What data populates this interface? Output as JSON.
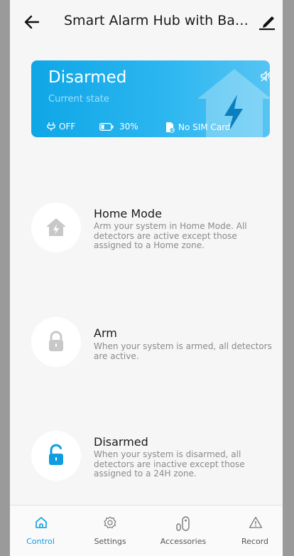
{
  "header": {
    "title": "Smart Alarm Hub with Bac...",
    "back_icon": "back-arrow-icon",
    "edit_icon": "edit-pencil-icon"
  },
  "status_card": {
    "state": "Disarmed",
    "subtitle": "Current state",
    "power": "OFF",
    "battery": "30%",
    "battery_level": 0.3,
    "sim": "No SIM Card",
    "gradient_start": "#0fa6e6",
    "gradient_end": "#55c4f3"
  },
  "modes": [
    {
      "title": "Home Mode",
      "description": "Arm your system in Home Mode. All detectors are active except those assigned to a Home zone.",
      "icon": "home-mode-icon"
    },
    {
      "title": "Arm",
      "description": "When your system is armed, all detectors are active.",
      "icon": "lock-icon"
    },
    {
      "title": "Disarmed",
      "description": "When your system is disarmed, all detectors are inactive except those assigned to a 24H zone.",
      "icon": "unlock-icon"
    }
  ],
  "nav": {
    "items": [
      {
        "label": "Control",
        "icon": "home-icon",
        "active": true
      },
      {
        "label": "Settings",
        "icon": "gear-icon",
        "active": false
      },
      {
        "label": "Accessories",
        "icon": "accessories-icon",
        "active": false
      },
      {
        "label": "Record",
        "icon": "warning-icon",
        "active": false
      }
    ]
  },
  "colors": {
    "accent": "#0e9de0",
    "background": "#f6f6f6",
    "inactive_icon": "#c8c8c8"
  }
}
